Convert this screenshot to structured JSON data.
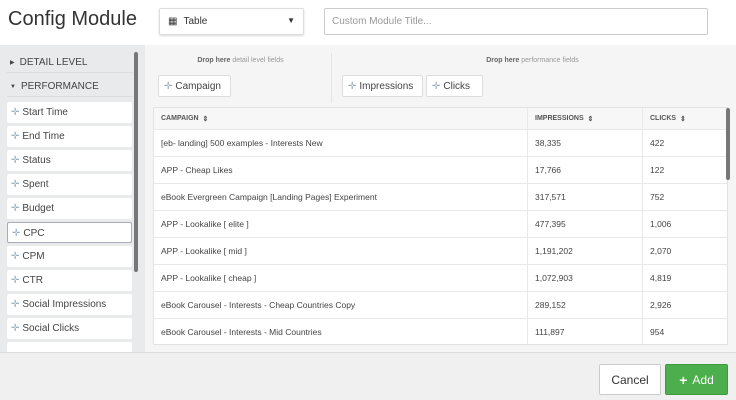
{
  "header": {
    "title": "Config Module",
    "view_select": {
      "icon": "table-icon",
      "value": "Table"
    },
    "title_input": {
      "placeholder": "Custom Module Title...",
      "value": ""
    }
  },
  "sidebar": {
    "sections": [
      {
        "label": "DETAIL LEVEL",
        "expanded": false
      },
      {
        "label": "PERFORMANCE",
        "expanded": true
      }
    ],
    "items": [
      "Start Time",
      "End Time",
      "Status",
      "Spent",
      "Budget",
      "CPC",
      "CPM",
      "CTR",
      "Social Impressions",
      "Social Clicks"
    ]
  },
  "dropzones": {
    "detail": {
      "bold": "Drop here",
      "rest": " detail level fields",
      "fields": [
        "Campaign"
      ]
    },
    "performance": {
      "bold": "Drop here",
      "rest": " performance fields",
      "fields": [
        "Impressions",
        "Clicks"
      ]
    }
  },
  "table": {
    "columns": [
      "CAMPAIGN",
      "IMPRESSIONS",
      "CLICKS"
    ],
    "sort_icon": "⇕",
    "rows": [
      [
        "[eb- landing] 500 examples - Interests New",
        "38,335",
        "422"
      ],
      [
        "APP - Cheap Likes",
        "17,766",
        "122"
      ],
      [
        "eBook Evergreen Campaign [Landing Pages] Experiment",
        "317,571",
        "752"
      ],
      [
        "APP - Lookalike [ elite ]",
        "477,395",
        "1,006"
      ],
      [
        "APP - Lookalike [ mid ]",
        "1,191,202",
        "2,070"
      ],
      [
        "APP - Lookalike [ cheap ]",
        "1,072,903",
        "4,819"
      ],
      [
        "eBook Carousel - Interests - Cheap Countries Copy",
        "289,152",
        "2,926"
      ],
      [
        "eBook Carousel - Interests - Mid Countries",
        "111,897",
        "954"
      ]
    ]
  },
  "footer": {
    "cancel": "Cancel",
    "add": "Add"
  },
  "colors": {
    "accent_green": "#4cae4c"
  }
}
